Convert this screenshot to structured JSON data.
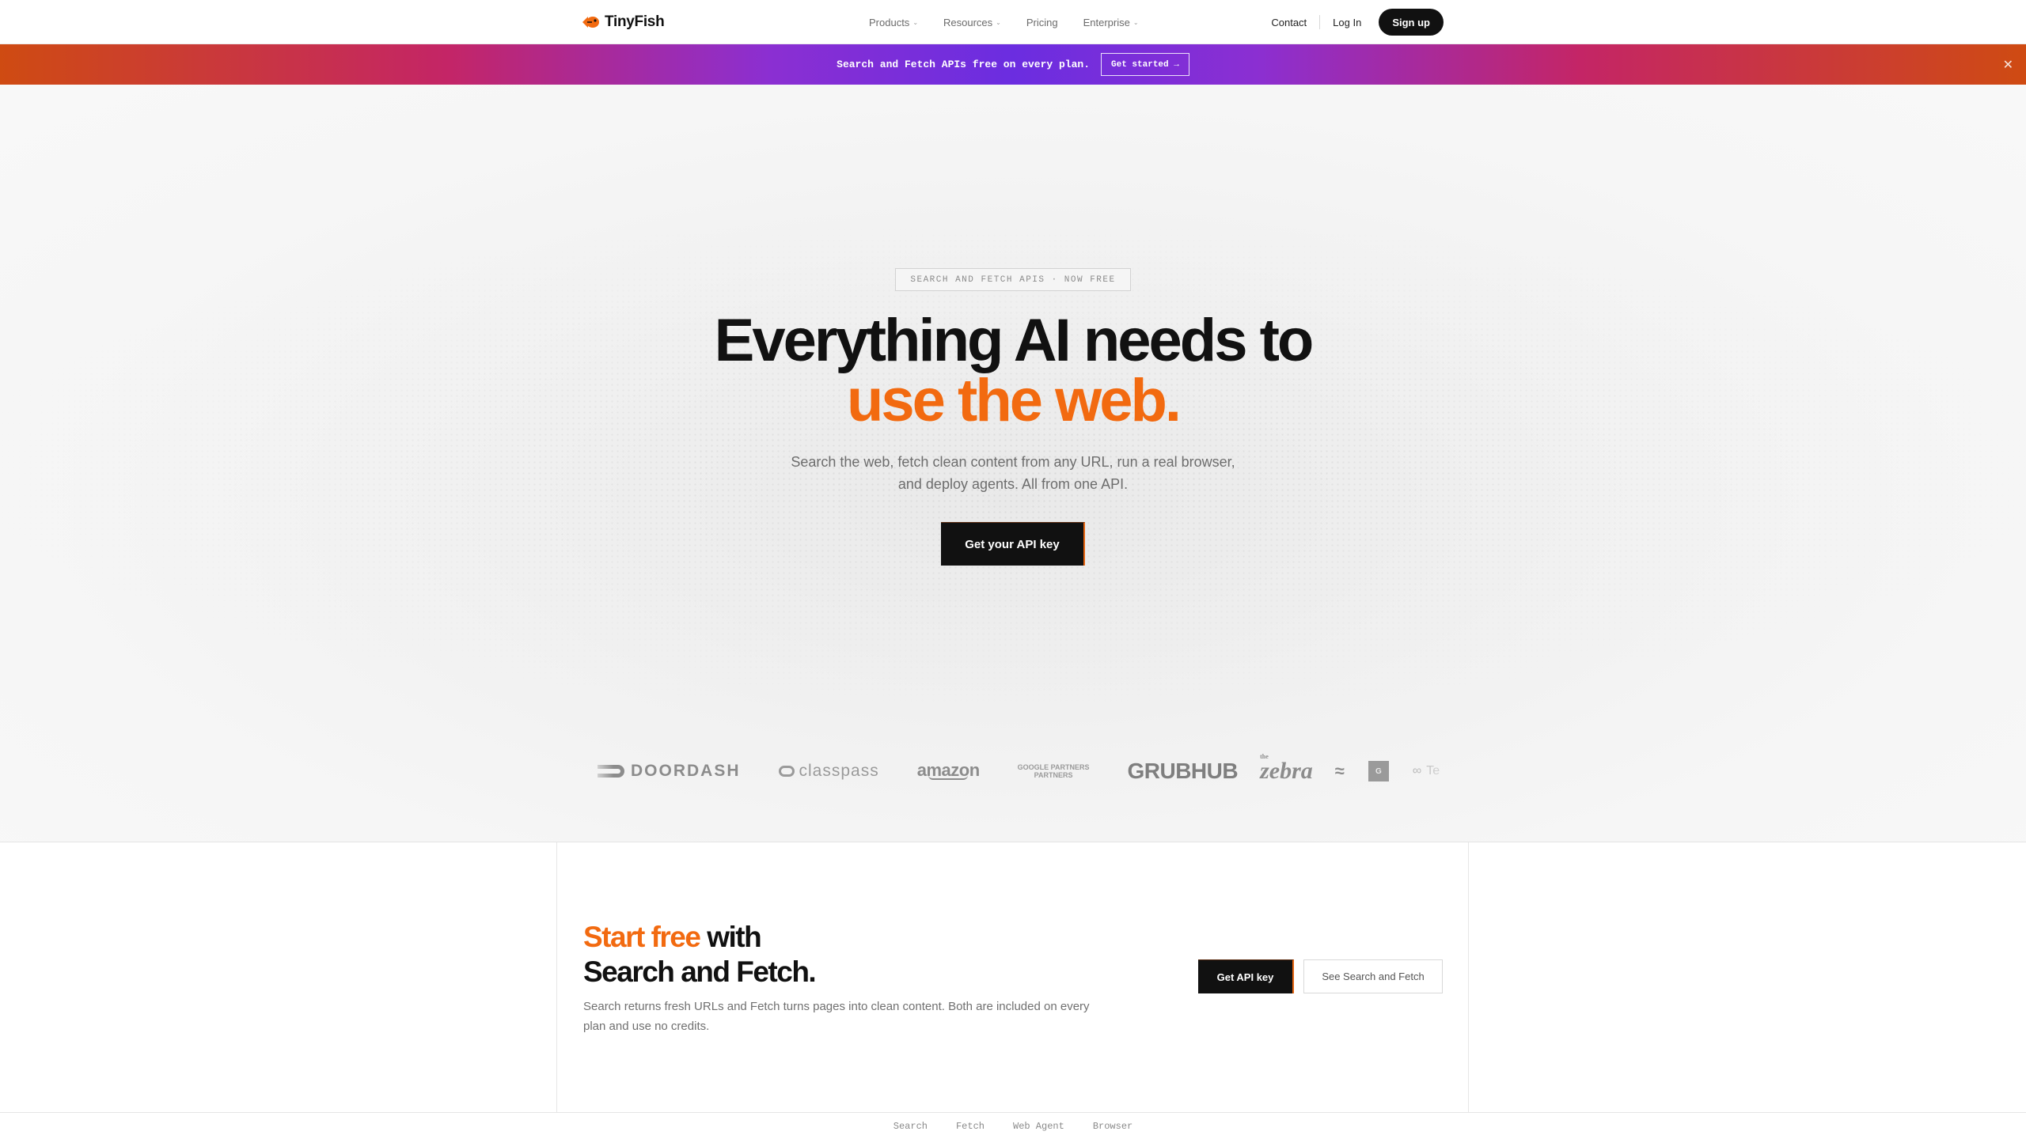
{
  "nav": {
    "logo_text": "TinyFish",
    "links": [
      {
        "label": "Products",
        "has_menu": true
      },
      {
        "label": "Resources",
        "has_menu": true
      },
      {
        "label": "Pricing",
        "has_menu": false
      },
      {
        "label": "Enterprise",
        "has_menu": true
      }
    ],
    "contact": "Contact",
    "login": "Log In",
    "signup": "Sign up"
  },
  "banner": {
    "text": "Search and Fetch APIs free on every plan.",
    "button": "Get started →",
    "close_icon": "close-icon",
    "gradient_colors": [
      "#cf4b12",
      "#c42566",
      "#6b2de0"
    ]
  },
  "hero": {
    "eyebrow": "SEARCH AND FETCH APIS · NOW FREE",
    "headline_line1": "Everything AI needs to",
    "headline_line2": "use the web.",
    "subtext_line1": "Search the web, fetch clean content from any URL, run a real browser,",
    "subtext_line2": "and deploy agents. All from one API.",
    "cta": "Get your API key",
    "accent_color": "#f26a10"
  },
  "logos": {
    "doordash": "DOORDASH",
    "classpass": "classpass",
    "amazon": "amazon",
    "partners_top": "GOOGLE PARTNERS",
    "partners_bottom": "PARTNERS",
    "grubhub": "GRUBHUB",
    "zebra_the": "the",
    "zebra": "zebra",
    "wave": "≈",
    "box": "G",
    "last": "Te"
  },
  "section2": {
    "title_accent": "Start free",
    "title_rest": " with",
    "title_line2": "Search and Fetch.",
    "description": "Search returns fresh URLs and Fetch turns pages into clean content. Both are included on every plan and use no credits.",
    "primary_button": "Get API key",
    "secondary_button": "See Search and Fetch"
  },
  "tabs": [
    "Search",
    "Fetch",
    "Web Agent",
    "Browser"
  ]
}
